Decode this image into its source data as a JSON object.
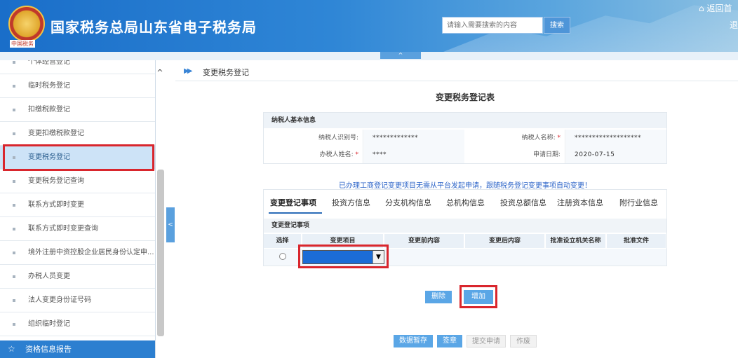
{
  "header": {
    "site_title": "国家税务总局山东省电子税务局",
    "emblem_caption": "中国税务",
    "search_placeholder": "请输入需要搜索的内容",
    "search_button": "搜索",
    "home_link": "返回首",
    "logout": "退",
    "collapse_label": "^"
  },
  "sidebar": {
    "up_arrow": "^",
    "items": [
      {
        "label": "个体经营登记"
      },
      {
        "label": "临时税务登记"
      },
      {
        "label": "扣缴税款登记"
      },
      {
        "label": "变更扣缴税款登记"
      },
      {
        "label": "变更税务登记"
      },
      {
        "label": "变更税务登记查询"
      },
      {
        "label": "联系方式即时变更"
      },
      {
        "label": "联系方式即时变更查询"
      },
      {
        "label": "境外注册中资控股企业居民身份认定申..."
      },
      {
        "label": "办税人员变更"
      },
      {
        "label": "法人变更身份证号码"
      },
      {
        "label": "组织临时登记"
      }
    ],
    "section": {
      "icon": "star-icon",
      "star": "☆",
      "label": "资格信息报告"
    },
    "handle": "<"
  },
  "breadcrumb": {
    "icon": "double-arrow-icon",
    "arrow": "▶▶",
    "text": "变更税务登记"
  },
  "form": {
    "title": "变更税务登记表",
    "basic_info_title": "纳税人基本信息",
    "taxpayer_id_label": "纳税人识别号:",
    "taxpayer_id_value": "*************",
    "taxpayer_name_label": "纳税人名称:",
    "taxpayer_name_value": "*******************",
    "handler_label": "办税人姓名:",
    "handler_value": "****",
    "apply_date_label": "申请日期:",
    "apply_date_value": "2020-07-15",
    "required_mark": "*"
  },
  "notice": "已办理工商登记变更项目无需从平台发起申请，跟随税务登记变更事项自动变更！",
  "tabs": [
    {
      "label": "变更登记事项"
    },
    {
      "label": "投资方信息"
    },
    {
      "label": "分支机构信息"
    },
    {
      "label": "总机构信息"
    },
    {
      "label": "投资总额信息"
    },
    {
      "label": "注册资本信息"
    },
    {
      "label": "附行业信息"
    }
  ],
  "table": {
    "title": "变更登记事项",
    "columns": [
      "选择",
      "变更项目",
      "变更前内容",
      "变更后内容",
      "批准设立机关名称",
      "批准文件"
    ],
    "select_arrow": "▼"
  },
  "buttons": {
    "delete": "删除",
    "add": "增加",
    "save_draft": "数据暂存",
    "sign": "签章",
    "submit": "提交申请",
    "void": "作废"
  },
  "colors": {
    "header": "#1a6ec9",
    "accent": "#5aa6e6",
    "highlight": "#d9262d",
    "notice": "#2c64c8"
  }
}
